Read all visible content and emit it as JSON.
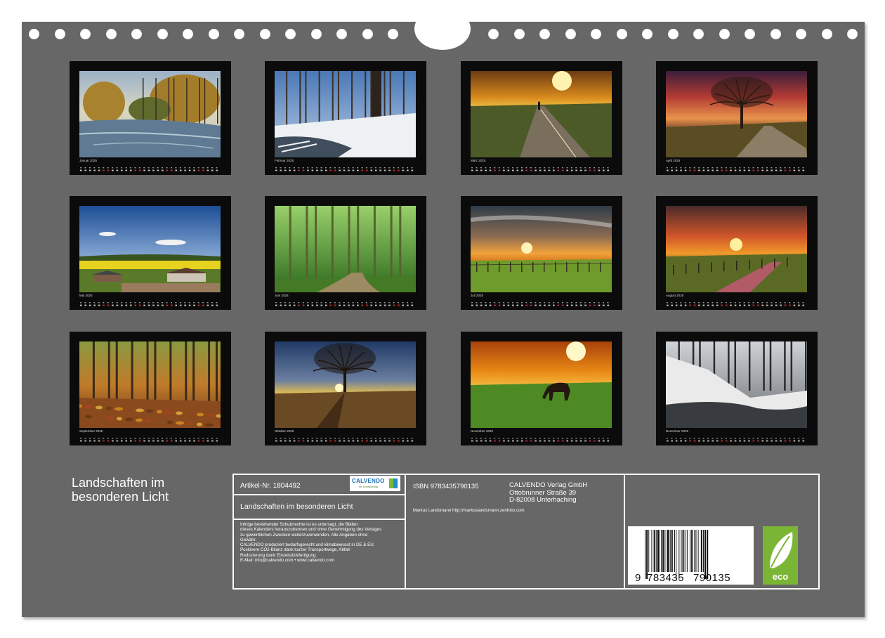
{
  "calendar_title": "Landschaften im besonderen Licht",
  "title_lines": [
    "Landschaften im",
    "besonderen Licht"
  ],
  "months": [
    {
      "label": "Januar 2025",
      "scene": "river-autumn-trees"
    },
    {
      "label": "Februar 2025",
      "scene": "snowy-forest-stream"
    },
    {
      "label": "März 2025",
      "scene": "sunrise-path-walker"
    },
    {
      "label": "April 2025",
      "scene": "red-sky-tree"
    },
    {
      "label": "Mai 2025",
      "scene": "rapeseed-farm"
    },
    {
      "label": "Juni 2025",
      "scene": "green-forest-path"
    },
    {
      "label": "Juli 2025",
      "scene": "sunset-pasture"
    },
    {
      "label": "August 2025",
      "scene": "sunset-road"
    },
    {
      "label": "September 2025",
      "scene": "autumn-forest-leaves"
    },
    {
      "label": "Oktober 2025",
      "scene": "tree-field-sunset"
    },
    {
      "label": "November 2025",
      "scene": "horse-sunset"
    },
    {
      "label": "Dezember 2025",
      "scene": "snowy-creek"
    }
  ],
  "info": {
    "article": "Artikel-Nr. 1804492",
    "calvendo_logo": "CALVENDO",
    "calvendo_logo_sub": "Ihr Kunstverlag",
    "product_title": "Landschaften im besonderen Licht",
    "legal_lines": [
      "Infolge bestehender Schutzrechte ist es untersagt, die Blätter",
      "dieses Kalenders herauszutrennen und ohne Genehmigung des Verlages",
      "zu gewerblichen Zwecken weiterzuverwenden. Alle Angaben ohne",
      "Gewähr.",
      "CALVENDO produziert bedarfsgerecht und klimabewusst in DE & EU.",
      "Positivere CO2-Bilanz dank kurzer Transportwege, Abfall-",
      "Reduzierung dank Einzelstückfertigung.",
      "E-Mail: info@calvendo.com • www.calvendo.com"
    ],
    "isbn": "ISBN 9783435790135",
    "publisher_lines": [
      "CALVENDO Verlag GmbH",
      "Ottobrunner Straße 39",
      "D-82008 Unterhaching"
    ],
    "author": "Markus Landsmann http://markuslandsmann.zenfolio.com",
    "barcode_digits": [
      "9",
      "783435",
      "790135"
    ],
    "eco_label": "eco",
    "eco_color": "#7bb536"
  }
}
